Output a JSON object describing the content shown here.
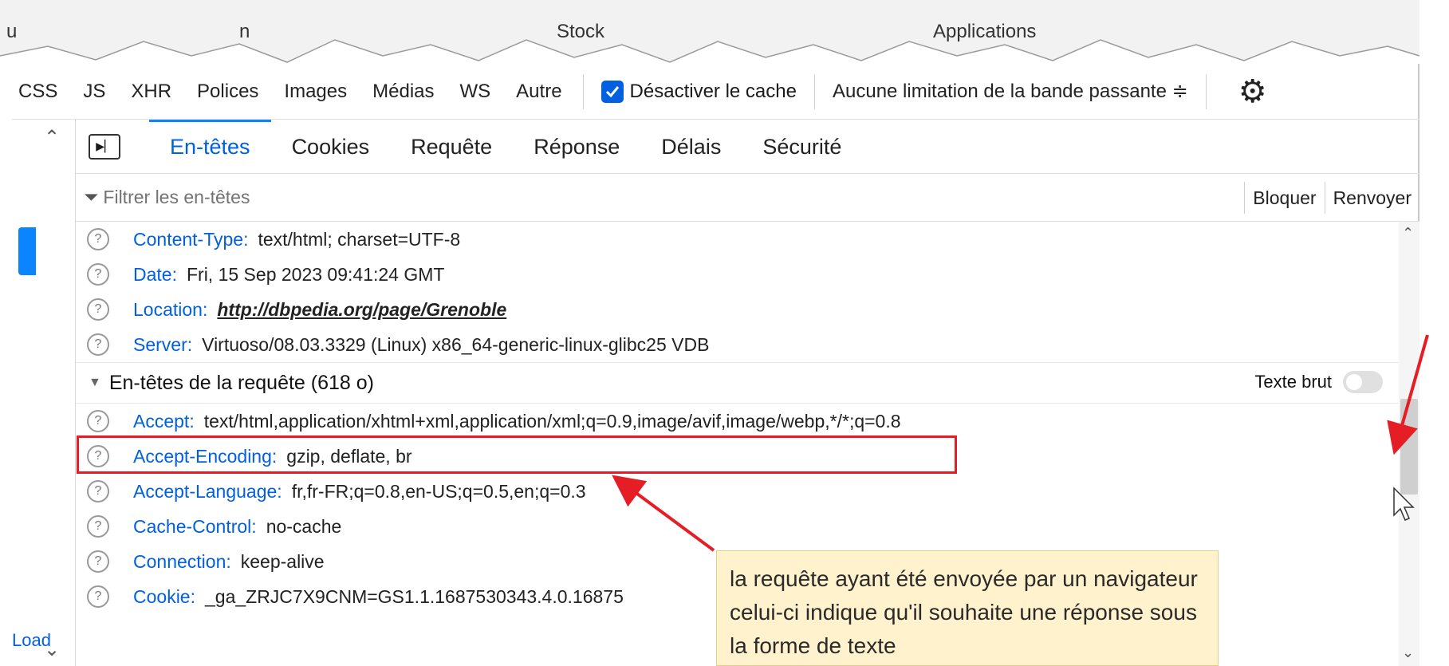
{
  "browser_tabs": {
    "fragments": [
      "u",
      "n",
      "Stock",
      "Applications"
    ]
  },
  "toolbar": {
    "filters": [
      "CSS",
      "JS",
      "XHR",
      "Polices",
      "Images",
      "Médias",
      "WS",
      "Autre"
    ],
    "disable_cache_label": "Désactiver le cache",
    "throttle_label": "Aucune limitation de la bande passante ≑",
    "settings_icon": "gear-icon"
  },
  "sidebar": {
    "load_text": "Load"
  },
  "details_tabs": {
    "toggle_icon": "sidebar-toggle-icon",
    "items": [
      "En-têtes",
      "Cookies",
      "Requête",
      "Réponse",
      "Délais",
      "Sécurité"
    ],
    "active": "En-têtes"
  },
  "header_filter": {
    "placeholder": "Filtrer les en-têtes",
    "block_label": "Bloquer",
    "resend_label": "Renvoyer"
  },
  "response_headers": [
    {
      "name": "Content-Type:",
      "value": "text/html; charset=UTF-8"
    },
    {
      "name": "Date:",
      "value": "Fri, 15 Sep 2023 09:41:24 GMT"
    },
    {
      "name": "Location:",
      "value": "http://dbpedia.org/page/Grenoble"
    },
    {
      "name": "Server:",
      "value": "Virtuoso/08.03.3329 (Linux) x86_64-generic-linux-glibc25 VDB"
    }
  ],
  "request_section": {
    "title": "En-têtes de la requête (618 o)",
    "raw_label": "Texte brut"
  },
  "request_headers": [
    {
      "name": "Accept:",
      "value": "text/html,application/xhtml+xml,application/xml;q=0.9,image/avif,image/webp,*/*;q=0.8"
    },
    {
      "name": "Accept-Encoding:",
      "value": "gzip, deflate, br"
    },
    {
      "name": "Accept-Language:",
      "value": "fr,fr-FR;q=0.8,en-US;q=0.5,en;q=0.3"
    },
    {
      "name": "Cache-Control:",
      "value": "no-cache"
    },
    {
      "name": "Connection:",
      "value": "keep-alive"
    },
    {
      "name": "Cookie:",
      "value": "_ga_ZRJC7X9CNM=GS1.1.1687530343.4.0.16875"
    }
  ],
  "annotation": {
    "callout_text": "la requête ayant été envoyée par un navigateur celui-ci indique qu'il souhaite une réponse sous la forme de texte",
    "highlight_color": "#e51e25",
    "callout_color": "#fff2cc"
  },
  "colors": {
    "accent": "#0060df",
    "active_tab_border": "#0a84ff"
  }
}
